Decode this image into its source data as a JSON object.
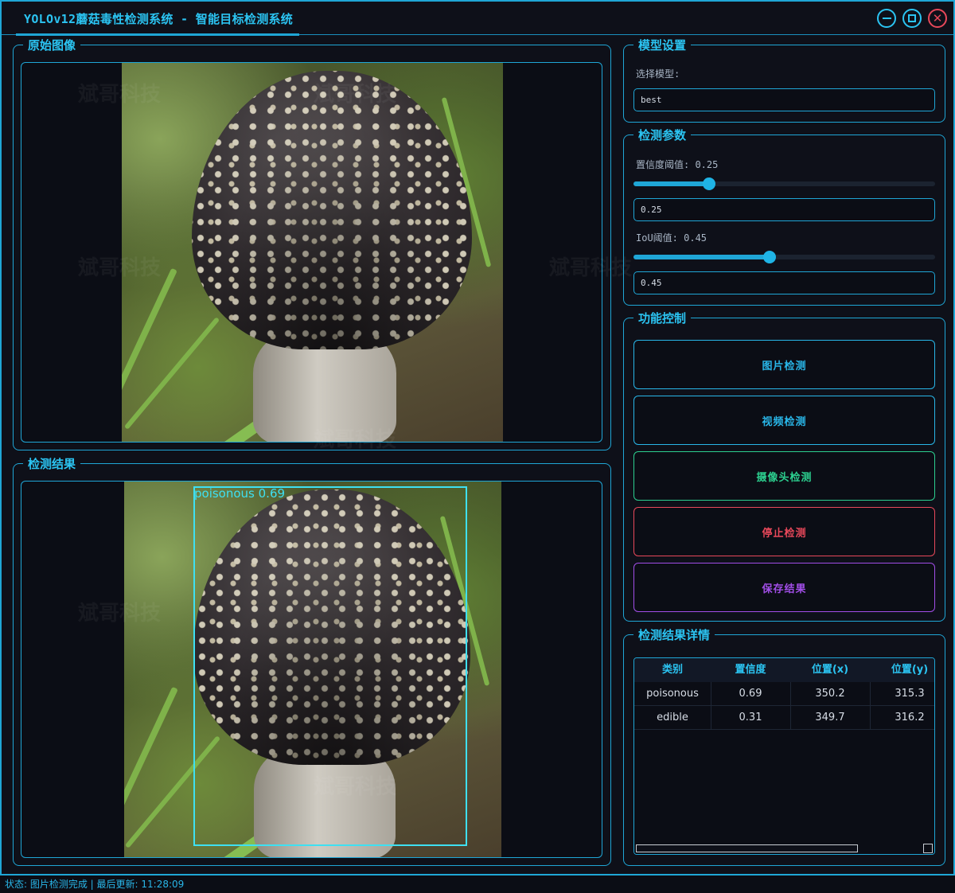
{
  "window": {
    "title": "YOLOv12蘑菇毒性检测系统 - 智能目标检测系统",
    "minimize_icon": "minimize-icon",
    "maximize_icon": "maximize-icon",
    "close_icon": "close-icon"
  },
  "original": {
    "title": "原始图像"
  },
  "result": {
    "title": "检测结果",
    "detection_label": "poisonous  0.69"
  },
  "watermark": "斌哥科技",
  "model": {
    "title": "模型设置",
    "select_label": "选择模型:",
    "selected_model": "best"
  },
  "params": {
    "title": "检测参数",
    "conf_label": "置信度阈值: 0.25",
    "conf_value": "0.25",
    "conf_fraction": 0.25,
    "iou_label": "IoU阈值: 0.45",
    "iou_value": "0.45",
    "iou_fraction": 0.45
  },
  "controls": {
    "title": "功能控制",
    "buttons": [
      {
        "label": "图片检测",
        "color": "#29b6e8"
      },
      {
        "label": "视频检测",
        "color": "#29b6e8"
      },
      {
        "label": "摄像头检测",
        "color": "#2ccf8f"
      },
      {
        "label": "停止检测",
        "color": "#e8485a"
      },
      {
        "label": "保存结果",
        "color": "#a24ee8"
      }
    ]
  },
  "details": {
    "title": "检测结果详情",
    "columns": [
      "类别",
      "置信度",
      "位置(x)",
      "位置(y)"
    ],
    "rows": [
      [
        "poisonous",
        "0.69",
        "350.2",
        "315.3"
      ],
      [
        "edible",
        "0.31",
        "349.7",
        "316.2"
      ]
    ]
  },
  "status": {
    "text": "状态: 图片检测完成 | 最后更新: 11:28:09"
  },
  "colors": {
    "accent": "#1fa6d6",
    "detection_box": "#3ee0f2",
    "background": "#0e1019"
  }
}
